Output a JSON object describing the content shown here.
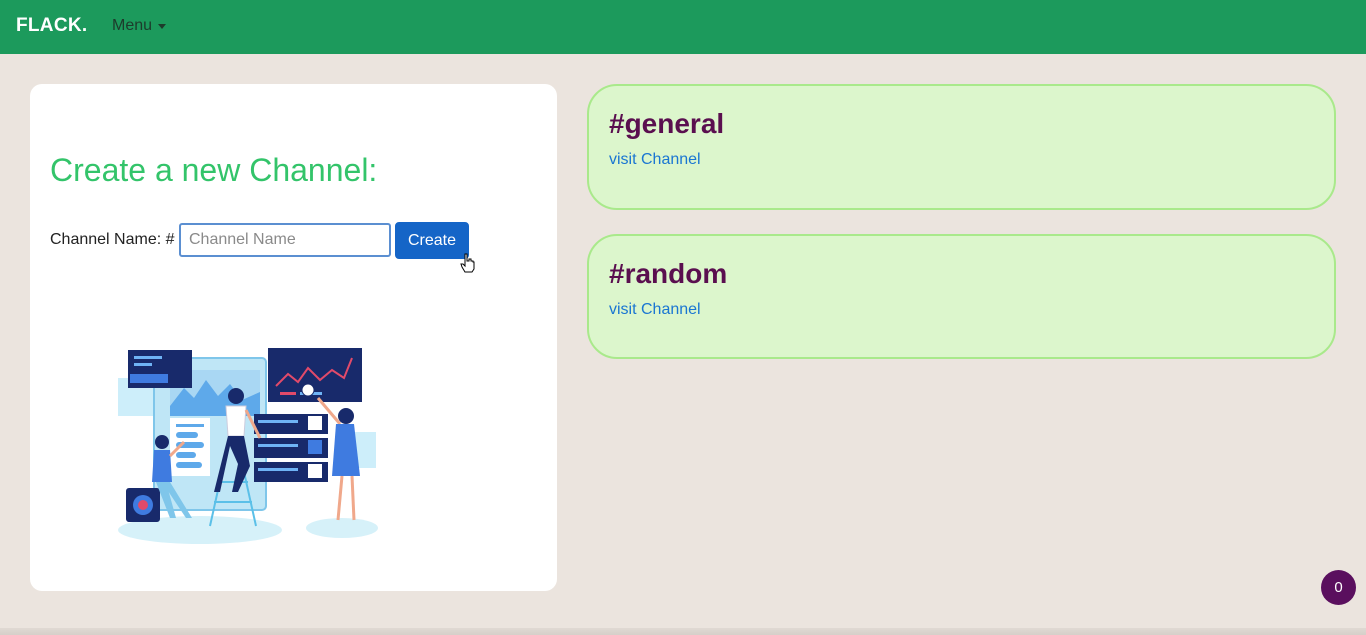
{
  "navbar": {
    "brand": "FLACK.",
    "menu_label": "Menu"
  },
  "create_panel": {
    "title": "Create a new Channel:",
    "label": "Channel Name: #",
    "input_value": "",
    "input_placeholder": "Channel Name",
    "button_label": "Create",
    "illustration": "team-dashboard-illustration"
  },
  "channels": [
    {
      "name": "#general",
      "link_label": "visit Channel"
    },
    {
      "name": "#random",
      "link_label": "visit Channel"
    }
  ],
  "notification_badge": {
    "count": "0"
  },
  "colors": {
    "navbar": "#1c9a5c",
    "background": "#ebe4de",
    "title_green": "#33c46a",
    "button_blue": "#1565c7",
    "card_fill": "#dcf6cc",
    "card_border": "#a9e98b",
    "channel_name": "#5a0f4f",
    "link": "#1a76d2",
    "badge": "#5a0f5e"
  }
}
